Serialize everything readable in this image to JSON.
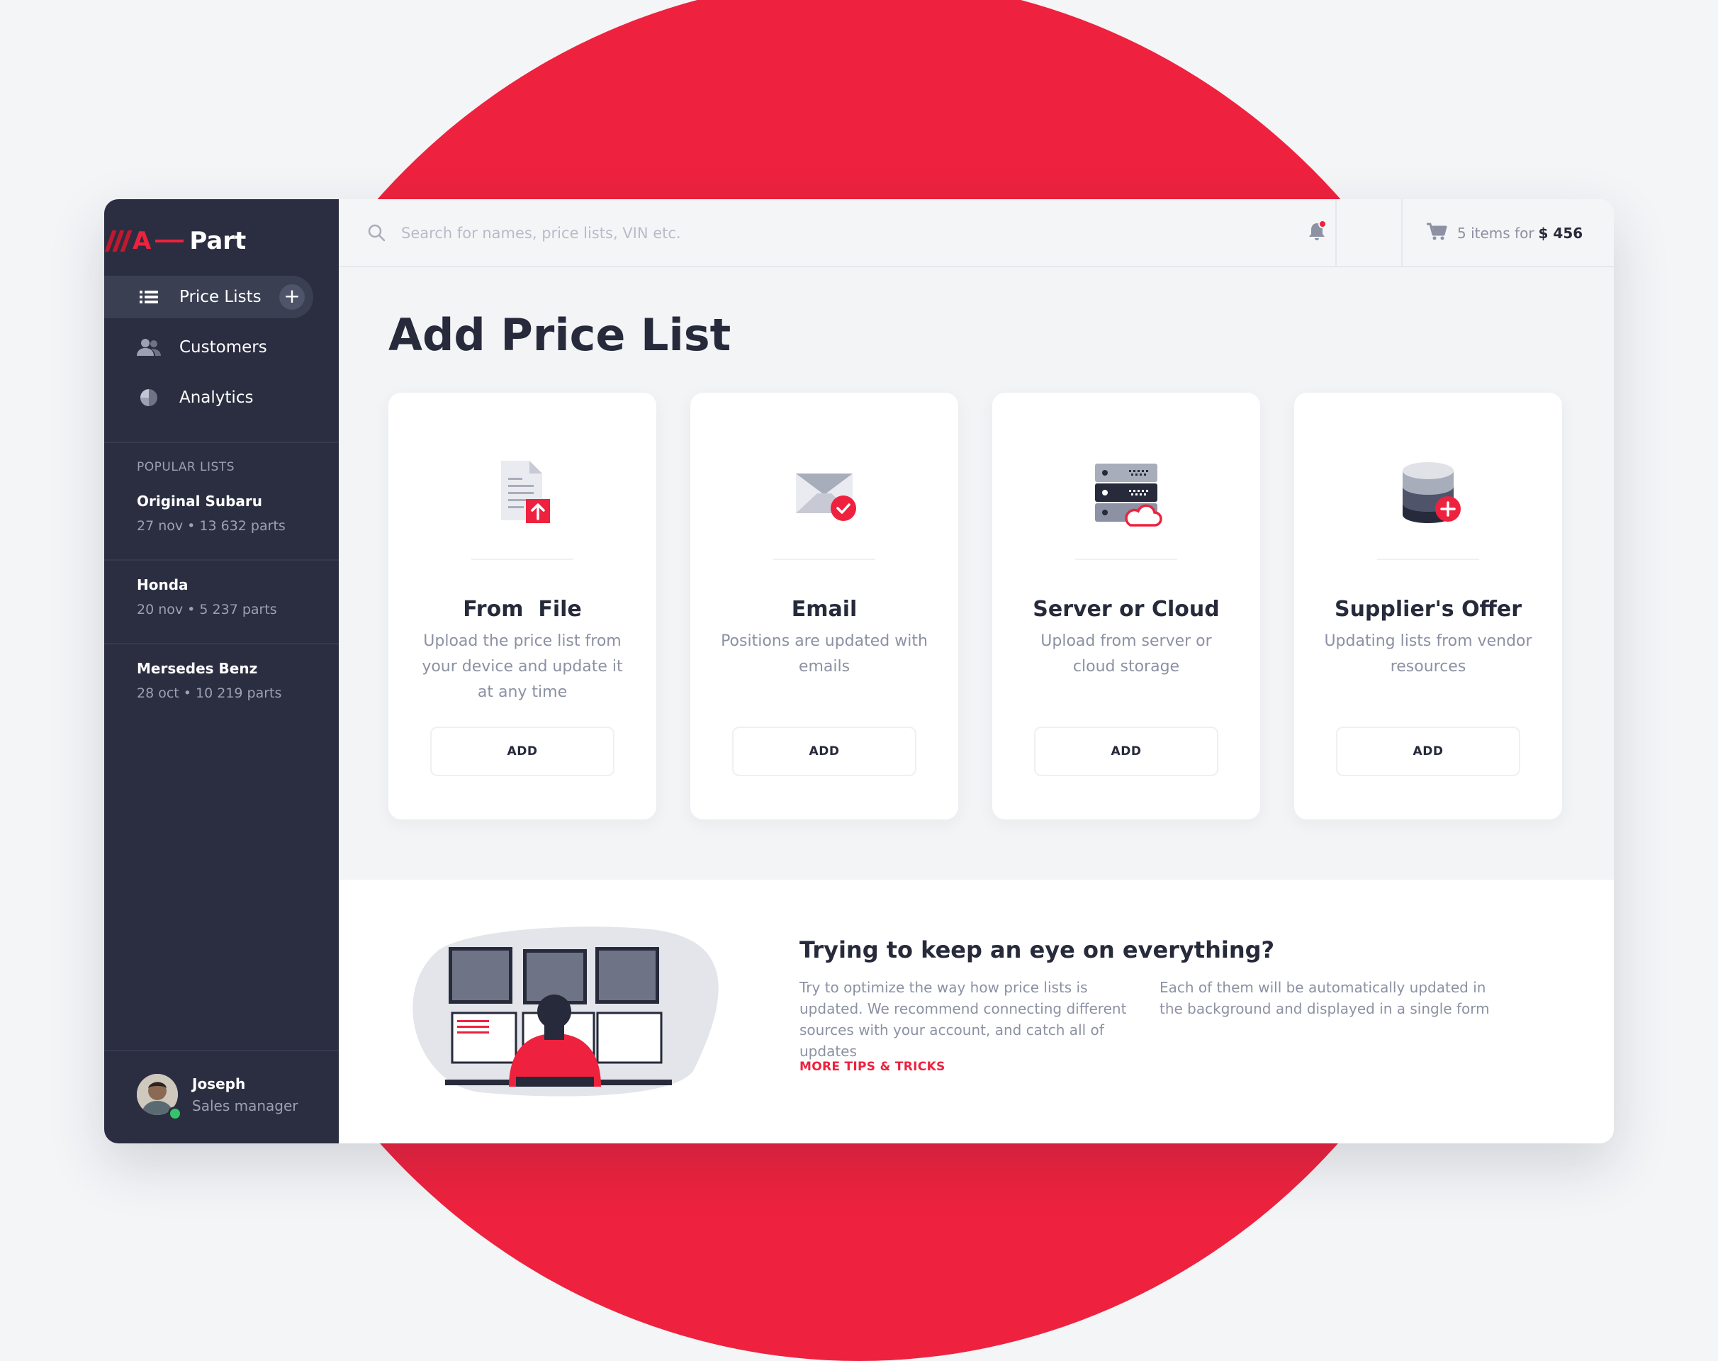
{
  "brand": {
    "logo_letter": "A",
    "logo_word": "Part"
  },
  "nav": [
    {
      "label": "Price Lists",
      "active": true
    },
    {
      "label": "Customers"
    },
    {
      "label": "Analytics"
    }
  ],
  "popular": {
    "title": "POPULAR LISTS",
    "items": [
      {
        "name": "Original Subaru",
        "meta": "27 nov  •  13 632 parts"
      },
      {
        "name": "Honda",
        "meta": "20 nov  •  5 237 parts"
      },
      {
        "name": "Mersedes Benz",
        "meta": "28 oct  •  10 219 parts"
      }
    ]
  },
  "user": {
    "name": "Joseph",
    "role": "Sales manager"
  },
  "search": {
    "placeholder": "Search for names, price lists, VIN etc."
  },
  "cart": {
    "text": "5 items for",
    "total": "$ 456"
  },
  "page": {
    "title": "Add Price List"
  },
  "cards": [
    {
      "icon": "file-upload-icon",
      "title": "From  File",
      "desc": "Upload the price list from your device and update it at any time",
      "button": "ADD"
    },
    {
      "icon": "email-check-icon",
      "title": "Email",
      "desc": "Positions are updated with emails",
      "button": "ADD"
    },
    {
      "icon": "server-cloud-icon",
      "title": "Server or Cloud",
      "desc": "Upload from server or cloud storage",
      "button": "ADD"
    },
    {
      "icon": "database-add-icon",
      "title": "Supplier's Offer",
      "desc": "Updating lists from vendor resources",
      "button": "ADD"
    }
  ],
  "tips": {
    "title": "Trying to keep an eye on everything?",
    "p1": "Try to optimize the way how price lists is updated. We recommend connecting different sources with your account, and catch all of updates",
    "p2": "Each of them will be automatically updated in the background and displayed in a single form",
    "link": "MORE TIPS & TRICKS"
  },
  "colors": {
    "accent": "#ee223e",
    "sidebar": "#2b2e40",
    "text": "#262a3b",
    "muted": "#8c91a3"
  }
}
